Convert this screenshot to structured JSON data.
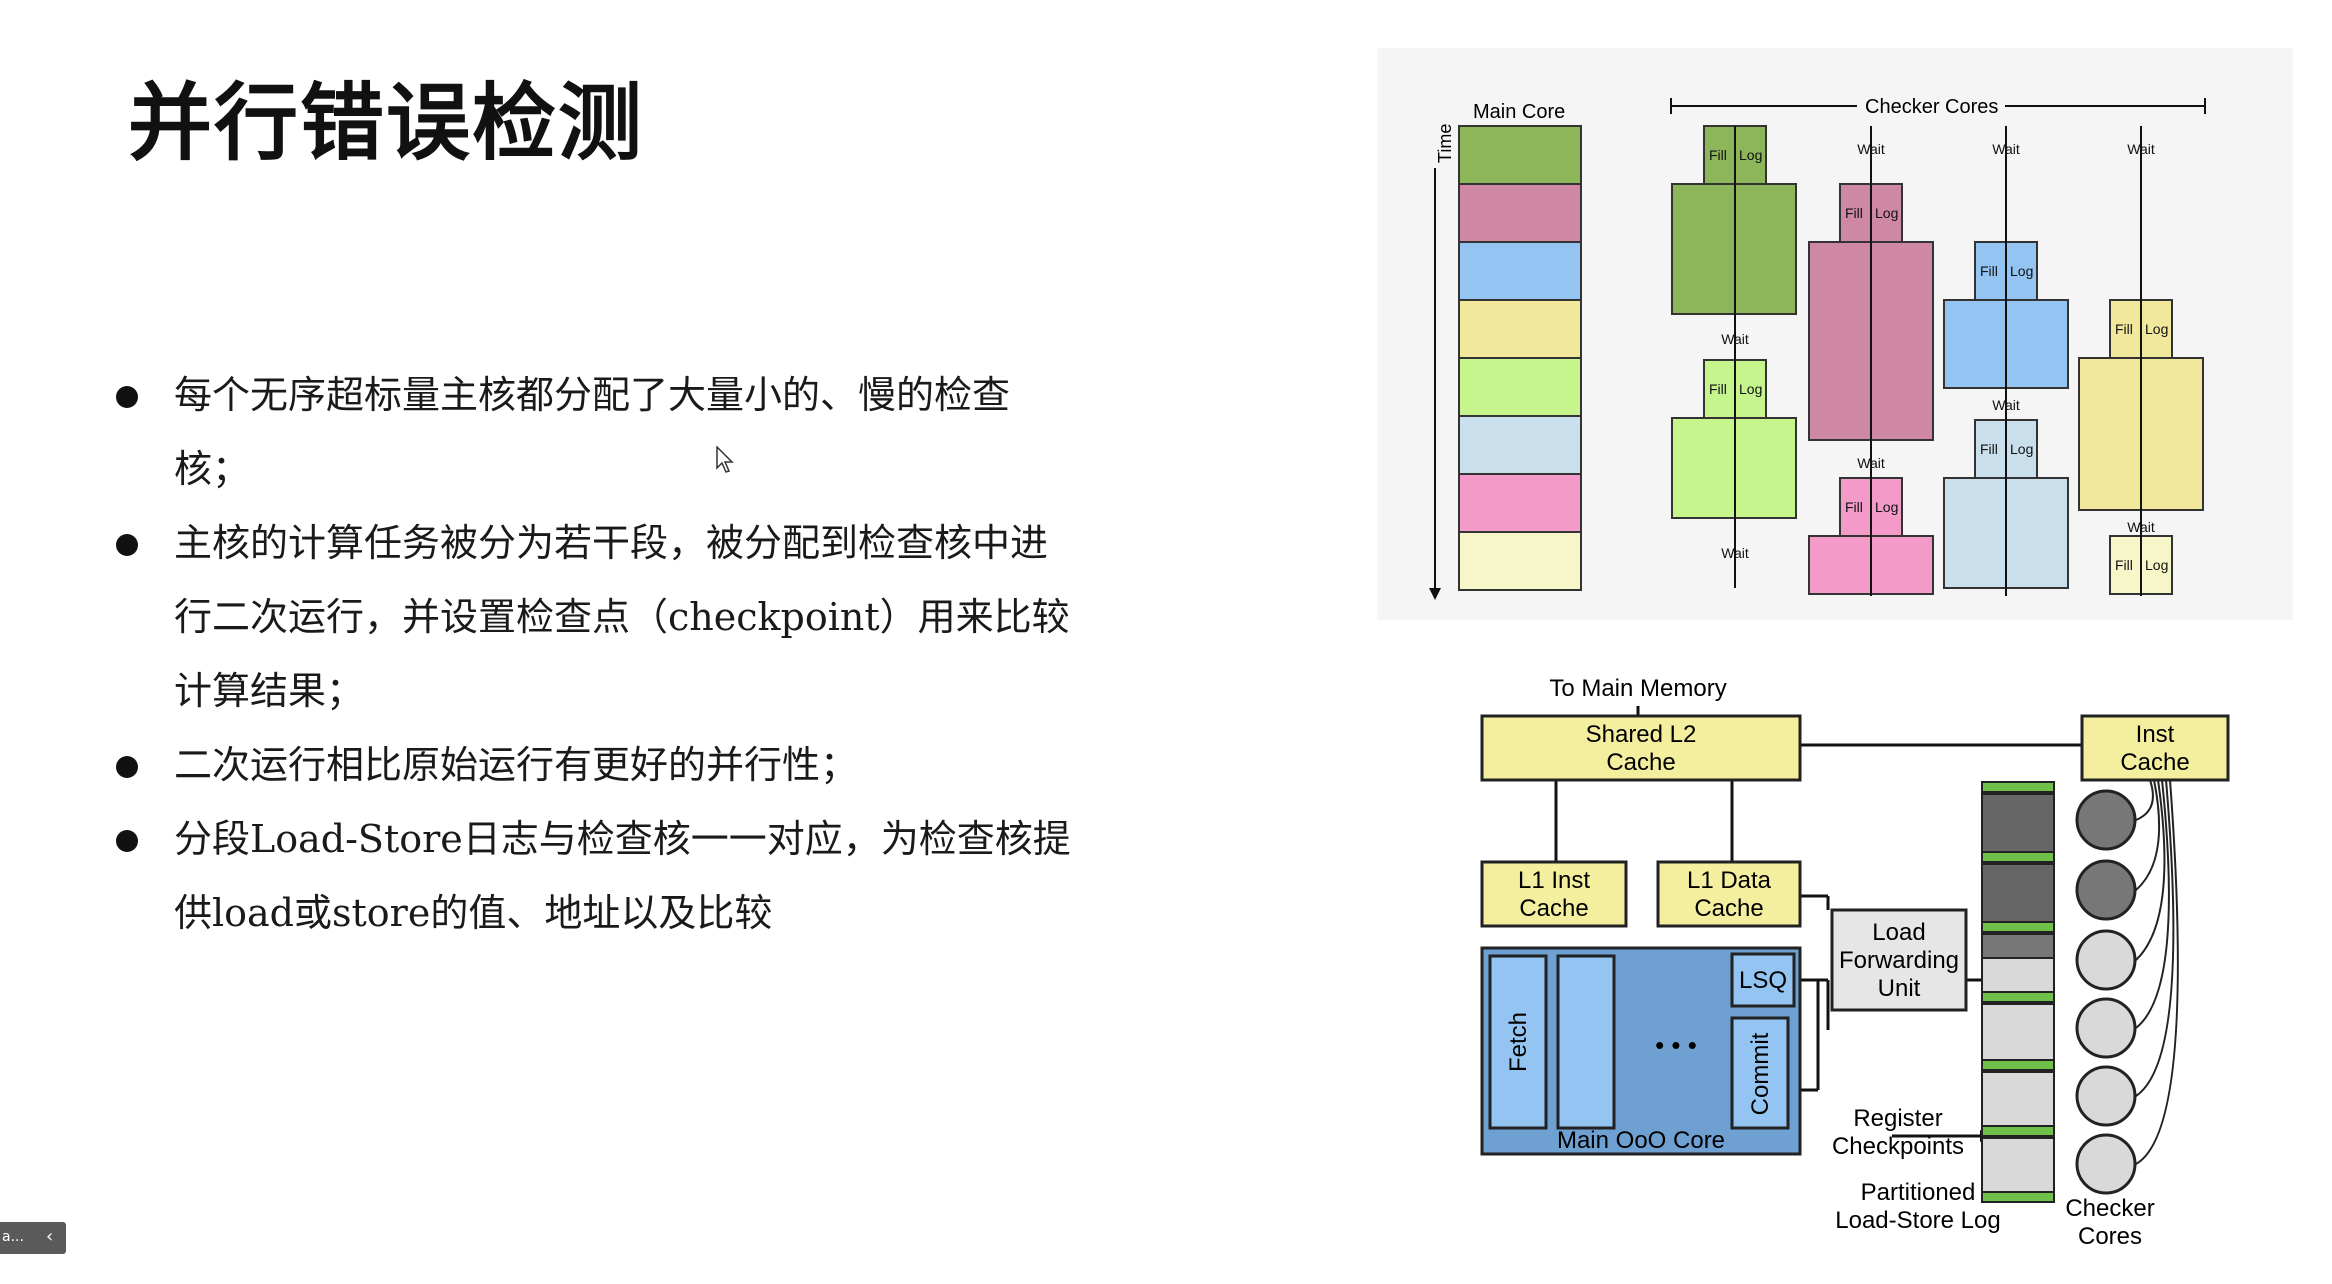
{
  "slide": {
    "title": "并行错误检测",
    "bullets": [
      "每个无序超标量主核都分配了大量小的、慢的检查核；",
      "主核的计算任务被分为若干段，被分配到检查核中进行二次运行，并设置检查点（checkpoint）用来比较计算结果；",
      "二次运行相比原始运行有更好的并行性；",
      "分段Load-Store日志与检查核一一对应，为检查核提供load或store的值、地址以及比较"
    ]
  },
  "timeline_figure": {
    "time_label": "Time",
    "main_core_label": "Main Core",
    "checker_cores_label": "Checker Cores",
    "wait_label": "Wait",
    "fill_label": "Fill",
    "log_label": "Log",
    "segment_colors": [
      "#8db55a",
      "#cf88a3",
      "#93c4f2",
      "#f1e89c",
      "#c6f58e",
      "#c9dfec",
      "#f49ac9",
      "#f7f6c8"
    ]
  },
  "arch_figure": {
    "to_main_memory": "To Main Memory",
    "shared_l2_line1": "Shared L2",
    "shared_l2_line2": "Cache",
    "inst_cache_line1": "Inst",
    "inst_cache_line2": "Cache",
    "l1_inst_line1": "L1 Inst",
    "l1_inst_line2": "Cache",
    "l1_data_line1": "L1 Data",
    "l1_data_line2": "Cache",
    "lfu_line1": "Load",
    "lfu_line2": "Forwarding",
    "lfu_line3": "Unit",
    "lsq": "LSQ",
    "fetch": "Fetch",
    "commit": "Commit",
    "ellipsis": "• • •",
    "main_core": "Main OoO Core",
    "reg_cp_line1": "Register",
    "reg_cp_line2": "Checkpoints",
    "plsl_line1": "Partitioned",
    "plsl_line2": "Load-Store Log",
    "checker_line1": "Checker",
    "checker_line2": "Cores"
  },
  "ui": {
    "toolbar_left": "a...",
    "toolbar_arrow": "‹"
  }
}
